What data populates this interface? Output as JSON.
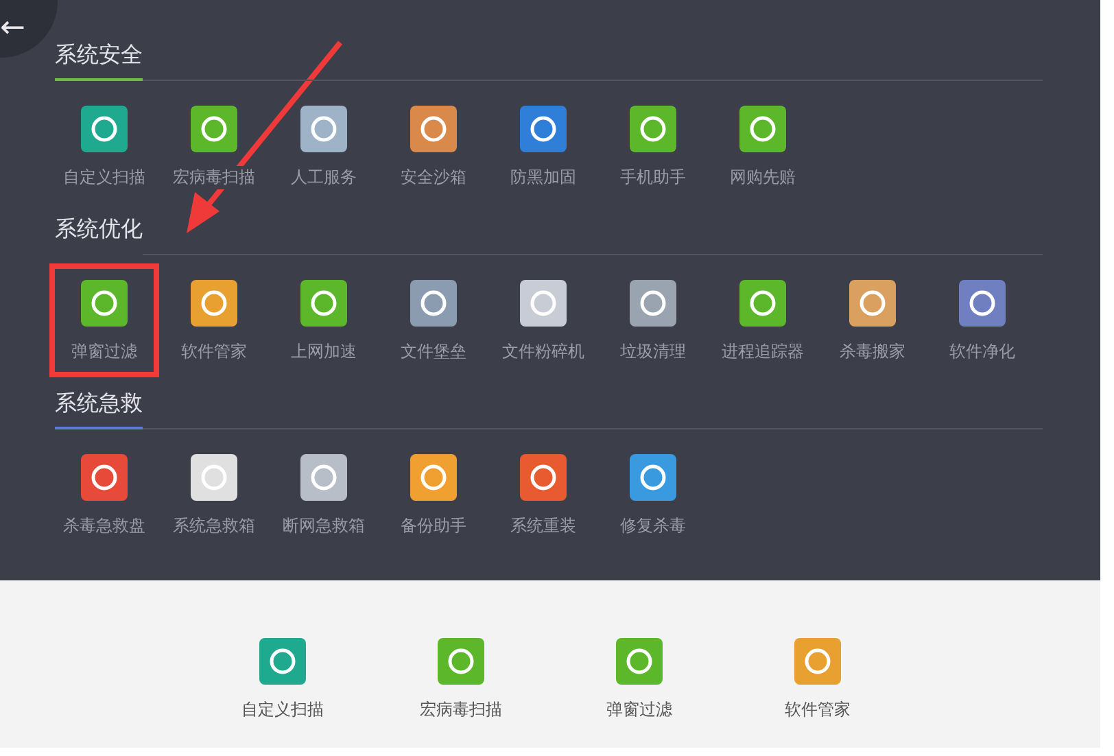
{
  "back_button": {
    "label": "←"
  },
  "sections": [
    {
      "title": "系统安全",
      "color": "#6cbf3c",
      "items": [
        {
          "label": "自定义扫描",
          "color": "#1fa98f",
          "highlighted": false
        },
        {
          "label": "宏病毒扫描",
          "color": "#5cb82a",
          "highlighted": false
        },
        {
          "label": "人工服务",
          "color": "#9fb3c8",
          "highlighted": false
        },
        {
          "label": "安全沙箱",
          "color": "#d9894a",
          "highlighted": false
        },
        {
          "label": "防黑加固",
          "color": "#2f7fd8",
          "highlighted": false
        },
        {
          "label": "手机助手",
          "color": "#5cb82a",
          "highlighted": false
        },
        {
          "label": "网购先赔",
          "color": "#5cb82a",
          "highlighted": false
        }
      ]
    },
    {
      "title": "系统优化",
      "color": "#3c3e4a",
      "items": [
        {
          "label": "弹窗过滤",
          "color": "#5cb82a",
          "highlighted": true
        },
        {
          "label": "软件管家",
          "color": "#e8a030",
          "highlighted": false
        },
        {
          "label": "上网加速",
          "color": "#5cb82a",
          "highlighted": false
        },
        {
          "label": "文件堡垒",
          "color": "#8c9cb0",
          "highlighted": false
        },
        {
          "label": "文件粉碎机",
          "color": "#c8ccd4",
          "highlighted": false
        },
        {
          "label": "垃圾清理",
          "color": "#9aa4b0",
          "highlighted": false
        },
        {
          "label": "进程追踪器",
          "color": "#5cb82a",
          "highlighted": false
        },
        {
          "label": "杀毒搬家",
          "color": "#d9a060",
          "highlighted": false
        },
        {
          "label": "软件净化",
          "color": "#6f7fc0",
          "highlighted": false
        }
      ]
    },
    {
      "title": "系统急救",
      "color": "#5b7fd6",
      "items": [
        {
          "label": "杀毒急救盘",
          "color": "#e84a3a",
          "highlighted": false
        },
        {
          "label": "系统急救箱",
          "color": "#e0e0e0",
          "highlighted": false
        },
        {
          "label": "断网急救箱",
          "color": "#b8bec8",
          "highlighted": false
        },
        {
          "label": "备份助手",
          "color": "#f0a030",
          "highlighted": false
        },
        {
          "label": "系统重装",
          "color": "#e85a30",
          "highlighted": false
        },
        {
          "label": "修复杀毒",
          "color": "#3a9ae0",
          "highlighted": false
        }
      ]
    }
  ],
  "quick_bar": [
    {
      "label": "自定义扫描",
      "color": "#1fa98f"
    },
    {
      "label": "宏病毒扫描",
      "color": "#5cb82a"
    },
    {
      "label": "弹窗过滤",
      "color": "#5cb82a"
    },
    {
      "label": "软件管家",
      "color": "#e8a030"
    }
  ]
}
